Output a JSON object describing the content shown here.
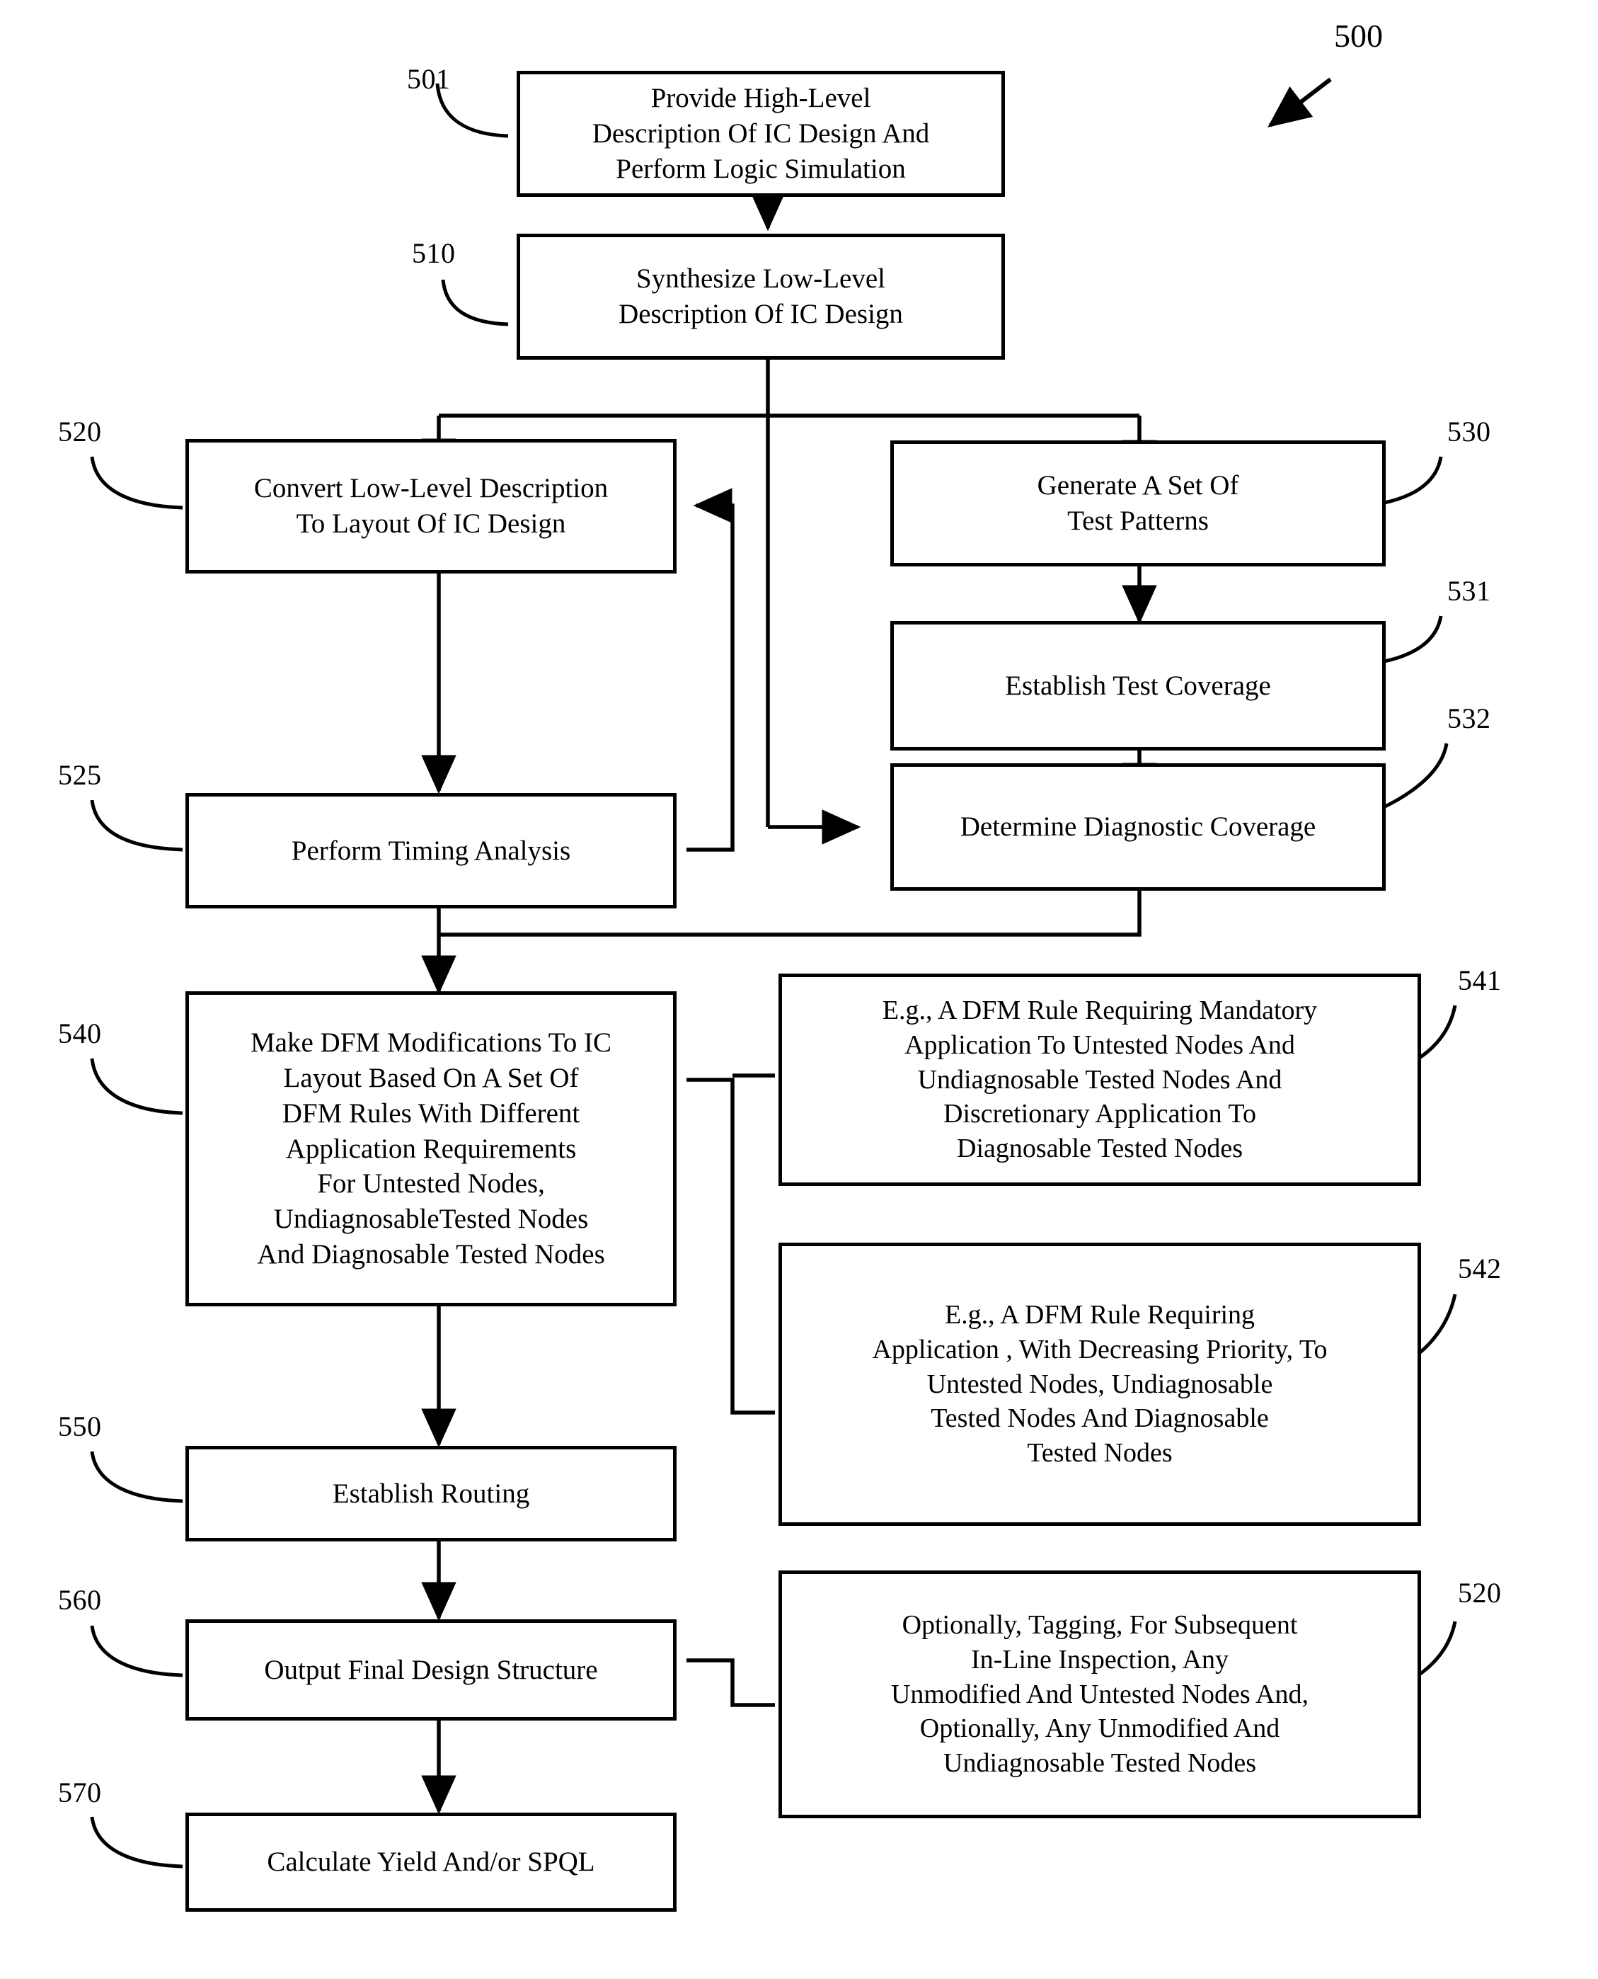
{
  "figure": {
    "number": "500",
    "type": "patent-flowchart",
    "title": ""
  },
  "nodes": [
    {
      "ref": "501",
      "name": "provide-high-level-description",
      "text": "Provide High-Level\nDescription Of IC Design And\nPerform Logic Simulation"
    },
    {
      "ref": "510",
      "name": "synthesize-low-level-description",
      "text": "Synthesize Low-Level\nDescription Of IC Design"
    },
    {
      "ref": "520",
      "name": "convert-low-level-to-layout",
      "text": "Convert Low-Level  Description\nTo Layout Of IC Design"
    },
    {
      "ref": "530",
      "name": "generate-test-patterns",
      "text": "Generate A Set Of\nTest  Patterns"
    },
    {
      "ref": "531",
      "name": "establish-test-coverage",
      "text": "Establish Test Coverage"
    },
    {
      "ref": "532",
      "name": "determine-diagnostic-coverage",
      "text": "Determine Diagnostic Coverage"
    },
    {
      "ref": "525",
      "name": "perform-timing-analysis",
      "text": "Perform Timing Analysis"
    },
    {
      "ref": "540",
      "name": "make-dfm-modifications",
      "text": "Make DFM Modifications To IC\nLayout Based On A Set Of\nDFM  Rules With Different\nApplication Requirements\nFor Untested Nodes,\nUndiagnosableTested Nodes\nAnd Diagnosable Tested Nodes"
    },
    {
      "ref": "541",
      "name": "dfm-rule-mandatory-application",
      "text": "E.g., A DFM Rule Requiring Mandatory\nApplication To Untested Nodes And\nUndiagnosable Tested Nodes And\nDiscretionary Application To\nDiagnosable Tested Nodes"
    },
    {
      "ref": "542",
      "name": "dfm-rule-decreasing-priority",
      "text": "E.g., A DFM Rule Requiring\nApplication , With Decreasing Priority, To\nUntested Nodes, Undiagnosable\nTested Nodes And Diagnosable\nTested Nodes"
    },
    {
      "ref": "550",
      "name": "establish-routing",
      "text": "Establish Routing"
    },
    {
      "ref": "560",
      "name": "output-final-design-structure",
      "text": "Output Final Design Structure"
    },
    {
      "ref": "520b",
      "name": "optionally-tagging-nodes",
      "text": "Optionally, Tagging, For Subsequent\nIn-Line Inspection, Any\nUnmodified And Untested Nodes And,\nOptionally, Any Unmodified And\nUndiagnosable Tested Nodes"
    },
    {
      "ref": "570",
      "name": "calculate-yield-spql",
      "text": "Calculate Yield And/or SPQL"
    }
  ],
  "ref_labels": {
    "n501": "501",
    "n510": "510",
    "n520": "520",
    "n530": "530",
    "n531": "531",
    "n532": "532",
    "n525": "525",
    "n540": "540",
    "n541": "541",
    "n542": "542",
    "n550": "550",
    "n560": "560",
    "n520b": "520",
    "n570": "570",
    "fig": "500"
  },
  "colors": {
    "stroke": "#000000",
    "background": "#ffffff",
    "text": "#000000"
  }
}
